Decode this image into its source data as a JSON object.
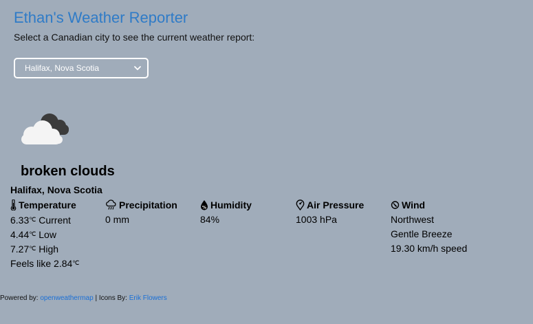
{
  "header": {
    "title": "Ethan's Weather Reporter",
    "subtitle": "Select a Canadian city to see the current weather report:"
  },
  "city_select": {
    "selected": "Halifax, Nova Scotia"
  },
  "weather": {
    "icon": "broken-clouds-icon",
    "description": "broken clouds",
    "location": "Halifax, Nova Scotia"
  },
  "stats": {
    "temperature": {
      "label": "Temperature",
      "icon": "thermometer-icon",
      "current": "6.33",
      "current_suffix": "Current",
      "low": "4.44",
      "low_suffix": "Low",
      "high": "7.27",
      "high_suffix": "High",
      "feels_prefix": "Feels like",
      "feels": "2.84",
      "unit": "℃"
    },
    "precipitation": {
      "label": "Precipitation",
      "icon": "rain-cloud-icon",
      "value": "0 mm"
    },
    "humidity": {
      "label": "Humidity",
      "icon": "humidity-drop-icon",
      "value": "84%"
    },
    "air_pressure": {
      "label": "Air Pressure",
      "icon": "barometer-icon",
      "value": "1003 hPa"
    },
    "wind": {
      "label": "Wind",
      "icon": "wind-compass-icon",
      "direction": "Northwest",
      "beaufort": "Gentle Breeze",
      "speed": "19.30 km/h speed"
    }
  },
  "footer": {
    "powered_prefix": "Powered by:",
    "powered_link": "openweathermap",
    "separator": "| Icons By:",
    "icons_link": "Erik Flowers"
  }
}
